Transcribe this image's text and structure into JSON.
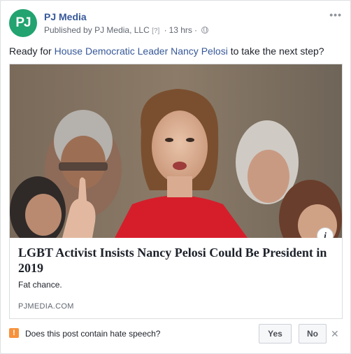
{
  "post": {
    "avatar_text": "PJ",
    "page_name": "PJ Media",
    "published_by_prefix": "Published by",
    "publisher": "PJ Media, LLC",
    "help_mark": "[?]",
    "time": "13 hrs",
    "privacy_icon": "globe-icon",
    "more_icon": "•••",
    "text_before": "Ready for ",
    "mention": "House Democratic Leader Nancy Pelosi",
    "text_after": " to take the next step?"
  },
  "link": {
    "title": "LGBT Activist Insists Nancy Pelosi Could Be President in 2019",
    "description": "Fat chance.",
    "domain": "PJMEDIA.COM",
    "info_icon": "i"
  },
  "survey": {
    "icon": "!",
    "question": "Does this post contain hate speech?",
    "yes_label": "Yes",
    "no_label": "No",
    "close_icon": "✕"
  },
  "colors": {
    "link_blue": "#365899",
    "avatar_green": "#22a36f",
    "warning_orange": "#f7923b"
  }
}
